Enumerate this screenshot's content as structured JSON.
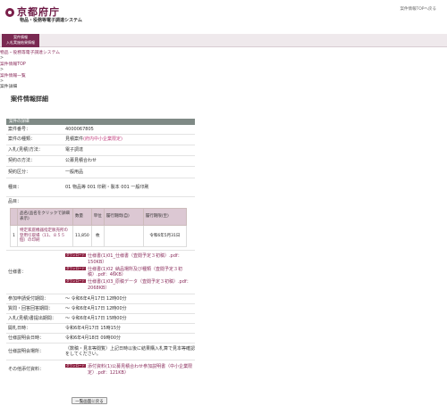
{
  "header": {
    "logo_text": "京都府庁",
    "system_name": "物品・役務等電子調達システム",
    "top_link": "案件情報TOPへ戻る"
  },
  "nav": {
    "tab_line1": "案件情報",
    "tab_line2": "入札実施結果情報"
  },
  "breadcrumb": {
    "level1": "物品・役務等電子調達システム",
    "sep1": ">",
    "level2": "案件情報TOP",
    "sep2": ">",
    "level3": "案件情報一覧",
    "sep3": ">",
    "current": "案件詳細"
  },
  "page_title": "案件情報詳細",
  "section_title": "案件の詳細",
  "info": {
    "case_no_label": "案件番号：",
    "case_no": "4000067805",
    "case_type_label": "案件の種類：",
    "case_type": "見積案件",
    "case_type_link": "(府内中小企業限定)",
    "bid_method_label": "入札(見積)方法：",
    "bid_method": "電子調達",
    "contract_method_label": "契約の方法：",
    "contract_method": "公募見積合わせ",
    "category_label": "契約区分：",
    "category": "一般用品",
    "class_label": "種目：",
    "class_value": "01 物品等 001 印刷・製本 001 一般印刷",
    "items_label": "品目：",
    "items_table": {
      "headers": [
        "",
        "品名(品名をクリックで詳細表示)",
        "数量",
        "単位",
        "履行期間(自)",
        "履行期限(至)"
      ],
      "rows": [
        {
          "no": "1",
          "name": "特定家庭機器指定販売所の登用引取場（11、８５５個）の印刷",
          "qty": "11,850",
          "unit": "枚",
          "from": "",
          "to": "令和6年5月31日"
        }
      ]
    },
    "spec_label": "仕様書：",
    "spec_docs": [
      {
        "badge": "ダウンロード",
        "text": "仕様書(1)01_仕様書（査閲予定３初稿）.pdf：150KB）"
      },
      {
        "badge": "ダウンロード",
        "text": "仕様書(1)02_納品場所及び種類（査閲予定３初稿）.pdf：46KB）"
      },
      {
        "badge": "ダウンロード",
        "text": "仕様書(1)03_原稿データ（査閲予定３初稿）.pdf：2068KB）"
      }
    ],
    "entry_period_label": "参加申請受付期間：",
    "entry_period": "～ 令和6年4月17日 12時00分",
    "question_period_label": "質問・回答回答期間：",
    "question_period": "～ 令和6年4月17日 12時00分",
    "submit_period_label": "入札(見積)書提出期間：",
    "submit_period": "～ 令和6年4月17日 15時00分",
    "open_date_label": "開札日時：",
    "open_date": "令和6年4月17日 15時15分",
    "explain_date_label": "仕様説明会日時：",
    "explain_date": "令和6年4月18日 09時00分",
    "explain_place_label": "仕様説明会場所：",
    "explain_place": "（数稿・見本等閲覧）上記日時以後に結果購入札算で見本等確認をしてください。",
    "other_label": "その他添付資料：",
    "other_docs": [
      {
        "badge": "ダウンロード",
        "text": "添付資料(1)公募見積合わせ参加説明書（中小企業限定）.pdf：121KB）"
      }
    ]
  },
  "back_button": "一覧画面に戻る"
}
